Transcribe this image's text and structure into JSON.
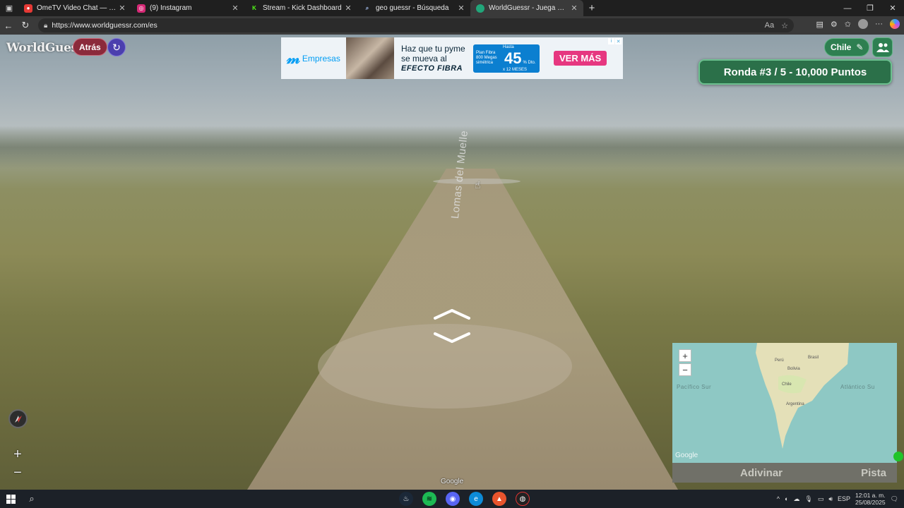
{
  "browser": {
    "tabs": [
      {
        "title": "OmeTV Video Chat — Omeg",
        "favicon_color": "#e53935"
      },
      {
        "title": "(9) Instagram",
        "favicon_color": "#d62976"
      },
      {
        "title": "Stream - Kick Dashboard",
        "favicon_color": "#53fc18"
      },
      {
        "title": "geo guessr - Búsqueda",
        "favicon_color": "#4a8df8"
      },
      {
        "title": "WorldGuessr - Juega GeoGuessr",
        "favicon_color": "#21a67a",
        "active": true
      }
    ],
    "url": "https://www.worldguessr.com/es"
  },
  "game": {
    "logo": "WorldGuessr",
    "back_label": "Atrás",
    "country_label": "Chile",
    "round_text": "Ronda #3 / 5 - 10,000 Puntos",
    "street_name": "Lomas del Muelle",
    "google_watermark": "Google",
    "guess_label": "Adivinar",
    "hint_label": "Pista"
  },
  "ad": {
    "brand": "Empresas",
    "headline_1": "Haz que tu pyme",
    "headline_2": "se mueva al",
    "headline_3": "EFECTO FIBRA",
    "promo_small": "Plan Fibra 800 Megas simétrica",
    "promo_hasta": "Hasta",
    "promo_percent": "45",
    "promo_dto": "% Dto.",
    "promo_months": "x 12 MESES",
    "cta": "VER MÁS"
  },
  "minimap": {
    "labels": [
      "Perú",
      "Brasil",
      "Bolivia",
      "Chile",
      "Argentina"
    ],
    "ocean_left": "Pacífico Sur",
    "ocean_right": "Atlántico Su",
    "google": "Google"
  },
  "taskbar": {
    "lang": "ESP",
    "time": "12:01 a. m.",
    "date": "25/08/2025"
  },
  "colors": {
    "back_button": "#8b2a3b",
    "refresh_button": "#4b3fae",
    "green_ui": "#2e7f51",
    "ad_cta": "#e63780",
    "movistar_blue": "#019df4"
  }
}
